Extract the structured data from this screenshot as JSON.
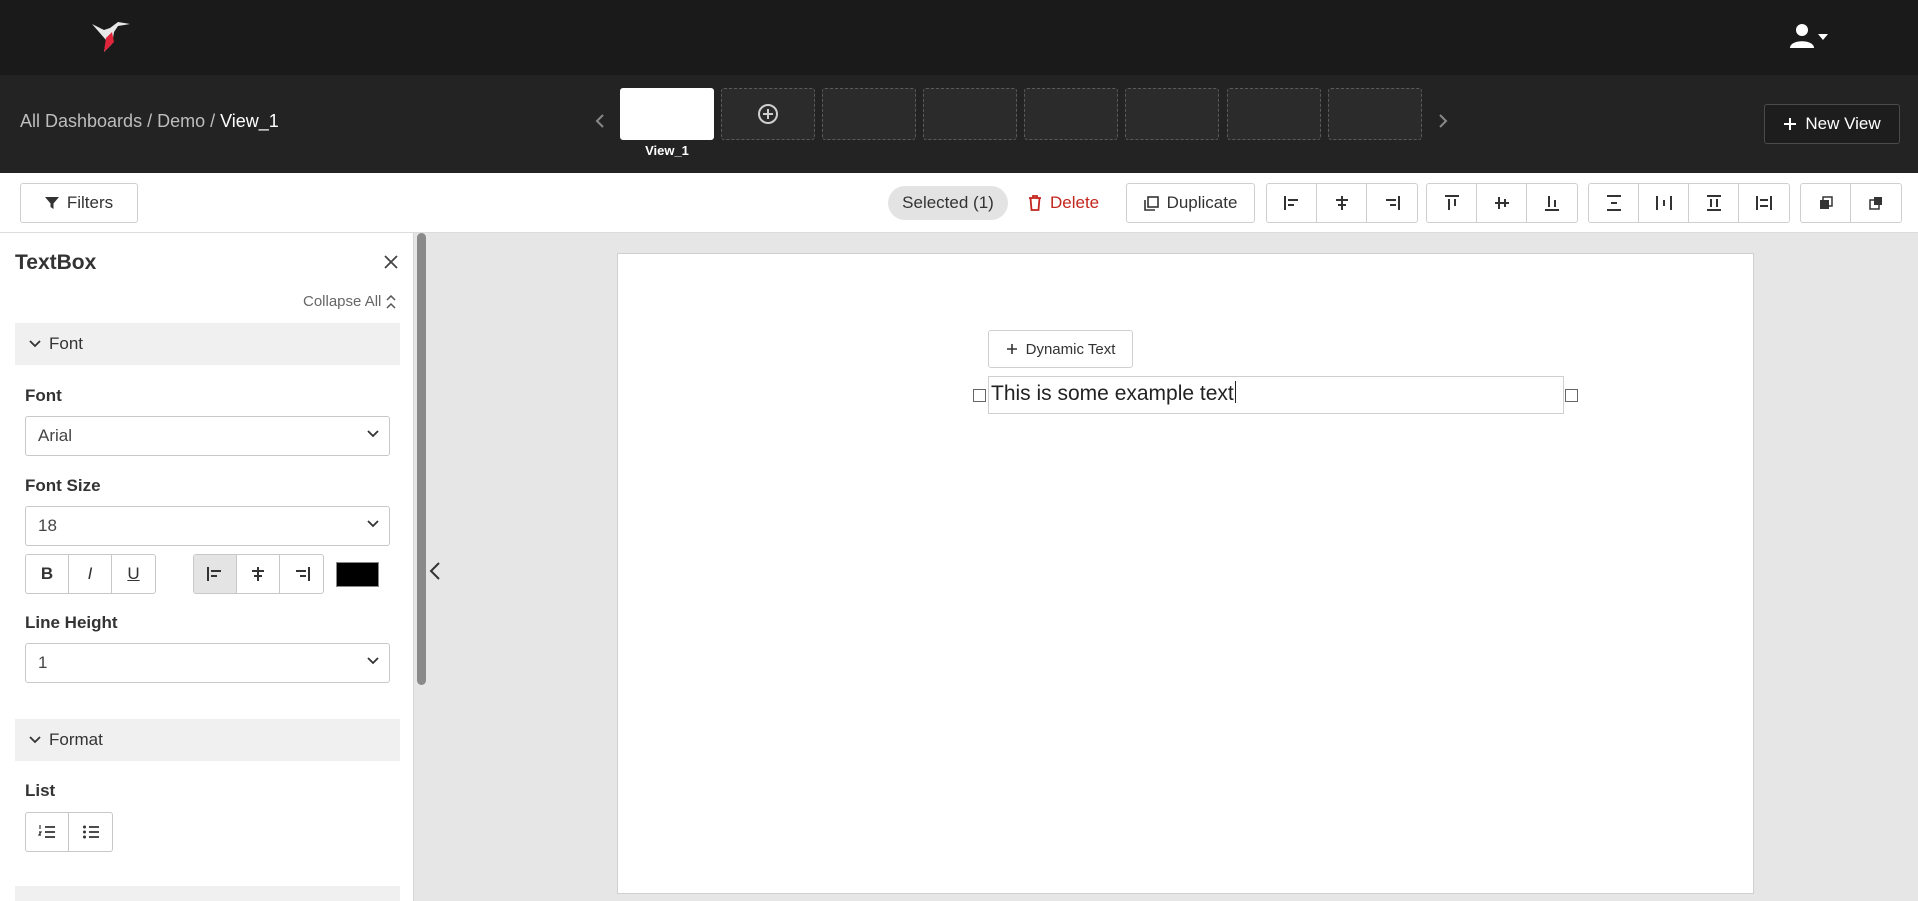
{
  "header": {
    "logo_icon": "hummingbird-logo-icon",
    "user_icon": "user-icon"
  },
  "navbar": {
    "breadcrumb": [
      {
        "label": "All Dashboards"
      },
      {
        "label": "Demo"
      },
      {
        "label": "View_1"
      }
    ],
    "separator": " / ",
    "views": [
      {
        "label": "View_1",
        "active": true
      }
    ],
    "new_view_label": "New View"
  },
  "toolbar": {
    "filters_label": "Filters",
    "selected_label": "Selected (1)",
    "delete_label": "Delete",
    "duplicate_label": "Duplicate",
    "delete_color": "#c3261d"
  },
  "panel": {
    "title": "TextBox",
    "collapse_all_label": "Collapse All",
    "sections": {
      "font": {
        "label": "Font",
        "font_label": "Font",
        "font_value": "Arial",
        "size_label": "Font Size",
        "size_value": "18",
        "bold_label": "B",
        "italic_label": "I",
        "underline_label": "U",
        "text_color": "#000000",
        "line_height_label": "Line Height",
        "line_height_value": "1"
      },
      "format": {
        "label": "Format",
        "list_label": "List"
      }
    }
  },
  "canvas": {
    "dynamic_text_label": "Dynamic Text",
    "textbox_value": "This is some example text"
  }
}
